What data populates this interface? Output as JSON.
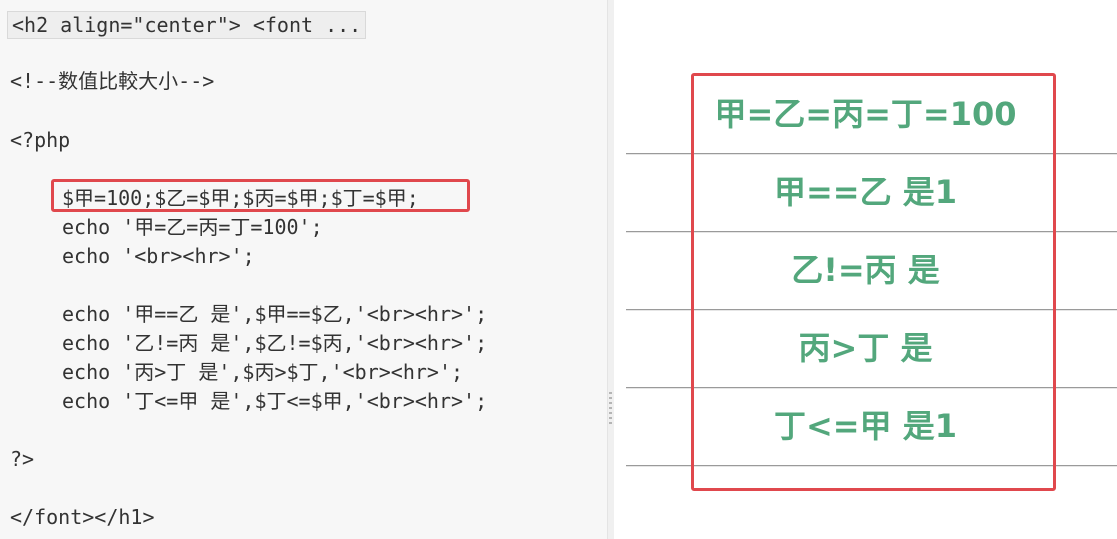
{
  "editor": {
    "collapsed_fold": "<h2 align=\"center\"> <font ...",
    "lines": {
      "comment": "<!--数值比較大小-->",
      "php_open": "<?php",
      "assign": "$甲=100;$乙=$甲;$丙=$甲;$丁=$甲;",
      "echo1": "echo '甲=乙=丙=丁=100';",
      "echo2": "echo '<br><hr>';",
      "echo3": "echo '甲==乙 是',$甲==$乙,'<br><hr>';",
      "echo4": "echo '乙!=丙 是',$乙!=$丙,'<br><hr>';",
      "echo5": "echo '丙>丁 是',$丙>$丁,'<br><hr>';",
      "echo6": "echo '丁<=甲 是',$丁<=$甲,'<br><hr>';",
      "php_close": "?>",
      "closing_tags": "</font></h1>"
    }
  },
  "preview": {
    "output_lines": [
      "甲=乙=丙=丁=100",
      "甲==乙 是1",
      "乙!=丙 是",
      "丙>丁 是",
      "丁<=甲 是1"
    ],
    "text_color": "#53a77c"
  },
  "highlight_color": "#e0484d"
}
